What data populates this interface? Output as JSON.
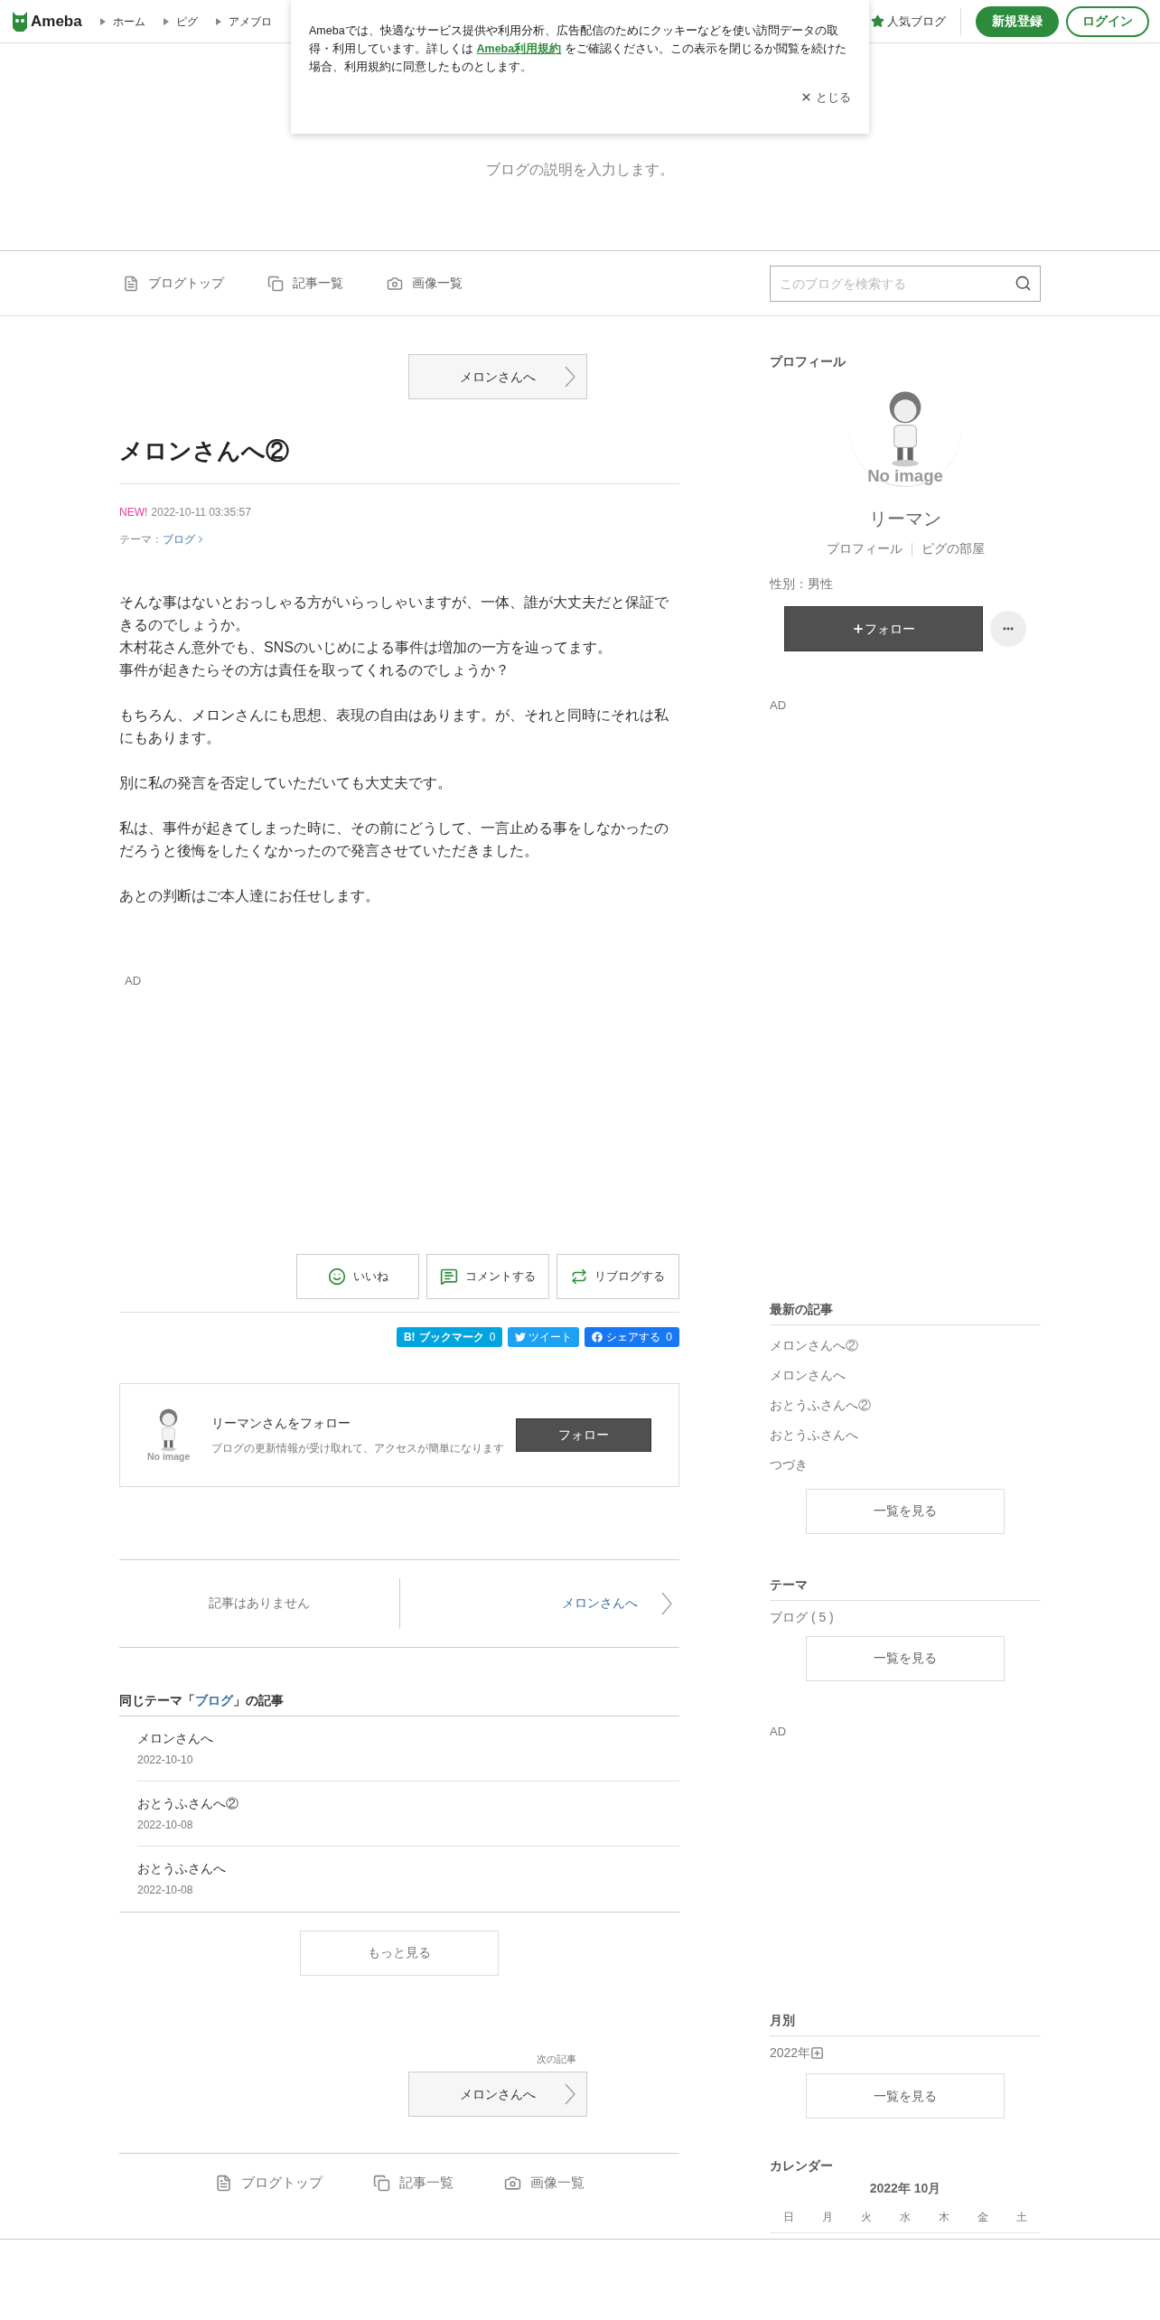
{
  "header": {
    "logo": "Ameba",
    "nav": [
      "ホーム",
      "ピグ",
      "アメブロ"
    ],
    "popular": "人気ブログ",
    "signup": "新規登録",
    "login": "ログイン"
  },
  "cookie_banner": {
    "before": "Amebaでは、快適なサービス提供や利用分析、広告配信のためにクッキーなどを使い訪問データの取得・利用しています。詳しくは ",
    "link": "Ameba利用規約",
    "after": " をご確認ください。この表示を閉じるか閲覧を続けた場合、利用規約に同意したものとします。",
    "close": "とじる"
  },
  "blog": {
    "description": "ブログの説明を入力します。"
  },
  "blog_nav": {
    "items": [
      {
        "label": "ブログトップ",
        "kind": "top"
      },
      {
        "label": "記事一覧",
        "kind": "entries"
      },
      {
        "label": "画像一覧",
        "kind": "images"
      }
    ],
    "search_placeholder": "このブログを検索する"
  },
  "article": {
    "prev_button": "メロンさんへ",
    "title": "メロンさんへ②",
    "new_badge": "NEW!",
    "date": "2022-10-11 03:35:57",
    "theme_label": "テーマ：",
    "theme_link": "ブログ",
    "paragraphs": [
      [
        "そんな事はないとおっしゃる方がいらっしゃいますが、一体、誰が大丈夫だと保証できるのでしょうか。",
        "木村花さん意外でも、SNSのいじめによる事件は増加の一方を辿ってます。",
        "事件が起きたらその方は責任を取ってくれるのでしょうか？"
      ],
      [
        "もちろん、メロンさんにも思想、表現の自由はあります。が、それと同時にそれは私にもあります。"
      ],
      [
        "別に私の発言を否定していただいても大丈夫です。"
      ],
      [
        "私は、事件が起きてしまった時に、その前にどうして、一言止める事をしなかったのだろうと後悔をしたくなかったので発言させていただきました。"
      ],
      [
        "あとの判断はご本人達にお任せします。"
      ]
    ],
    "ad": "AD",
    "actions": [
      {
        "label": "いいね",
        "kind": "like"
      },
      {
        "label": "コメントする",
        "kind": "comment"
      },
      {
        "label": "リブログする",
        "kind": "reblog"
      }
    ],
    "share": [
      {
        "icon_text": "B!",
        "label": "ブックマーク",
        "count": "0",
        "kind": "hatena",
        "color": "#00a4de"
      },
      {
        "label": "ツイート",
        "kind": "twitter",
        "color": "#1da1f2"
      },
      {
        "label": "シェアする",
        "count": "0",
        "kind": "facebook",
        "color": "#1877f2"
      }
    ],
    "follow_card": {
      "avatar_caption": "No image",
      "title": "リーマンさんをフォロー",
      "description": "ブログの更新情報が受け取れて、アクセスが簡単になります",
      "button": "フォロー"
    }
  },
  "pager": {
    "prev": "記事はありません",
    "next": "メロンさんへ"
  },
  "same_theme": {
    "before": "同じテーマ「",
    "link": "ブログ",
    "after": "」の記事",
    "items": [
      {
        "title": "メロンさんへ",
        "date": "2022-10-10"
      },
      {
        "title": "おとうふさんへ②",
        "date": "2022-10-08"
      },
      {
        "title": "おとうふさんへ",
        "date": "2022-10-08"
      }
    ],
    "more": "もっと見る"
  },
  "next_article": {
    "label": "次の記事",
    "button": "メロンさんへ"
  },
  "footer_nav": {
    "items": [
      {
        "label": "ブログトップ",
        "kind": "top"
      },
      {
        "label": "記事一覧",
        "kind": "entries"
      },
      {
        "label": "画像一覧",
        "kind": "images"
      }
    ]
  },
  "sidebar": {
    "profile": {
      "heading": "プロフィール",
      "avatar_caption": "No image",
      "name": "リーマン",
      "links": [
        "プロフィール",
        "ピグの部屋"
      ],
      "gender": "性別：男性",
      "follow": "フォロー"
    },
    "ad": "AD",
    "recent": {
      "heading": "最新の記事",
      "items": [
        "メロンさんへ②",
        "メロンさんへ",
        "おとうふさんへ②",
        "おとうふさんへ",
        "つづき"
      ],
      "more": "一覧を見る"
    },
    "theme": {
      "heading": "テーマ",
      "items": [
        "ブログ ( 5 )"
      ],
      "more": "一覧を見る"
    },
    "ad2": "AD",
    "monthly": {
      "heading": "月別",
      "years": [
        "2022年"
      ],
      "more": "一覧を見る"
    },
    "calendar": {
      "heading": "カレンダー",
      "month": "2022年 10月",
      "weekdays": [
        "日",
        "月",
        "火",
        "水",
        "木",
        "金",
        "土"
      ]
    }
  }
}
